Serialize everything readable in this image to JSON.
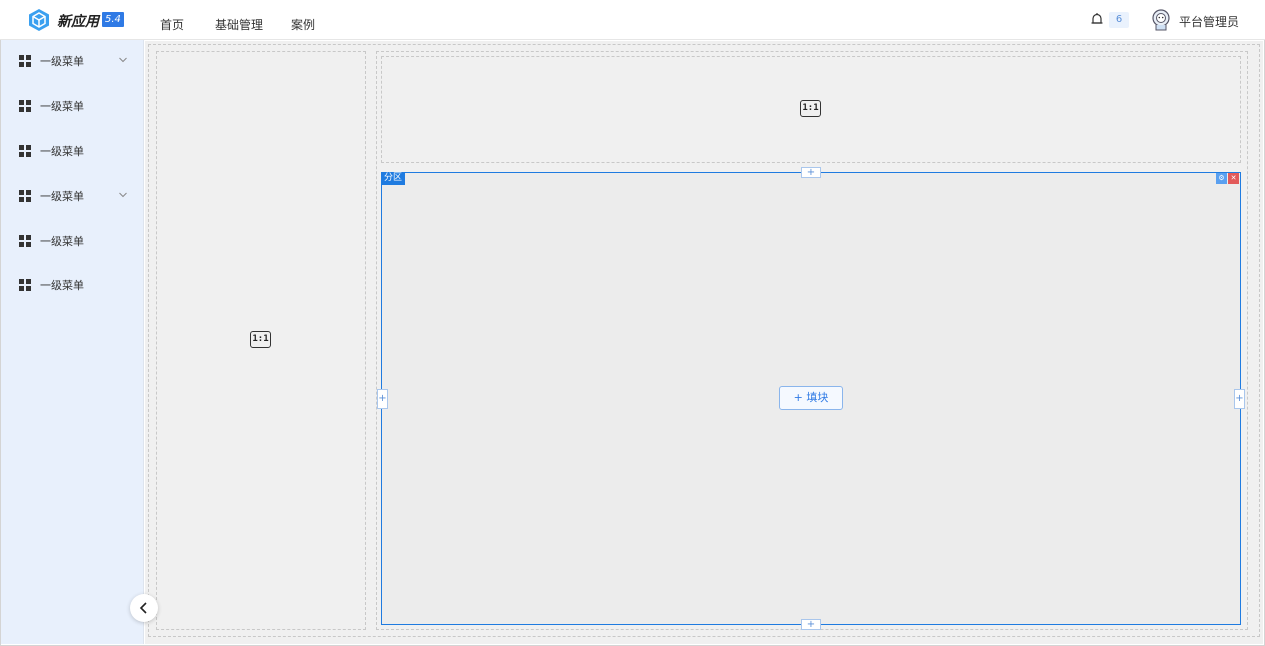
{
  "header": {
    "app_name": "新应用",
    "version": "5.4",
    "nav": [
      "首页",
      "基础管理",
      "案例"
    ],
    "notification_count": "6",
    "user_name": "平台管理员"
  },
  "sidebar": {
    "items": [
      {
        "label": "一级菜单",
        "has_children": true
      },
      {
        "label": "一级菜单",
        "has_children": false
      },
      {
        "label": "一级菜单",
        "has_children": false
      },
      {
        "label": "一级菜单",
        "has_children": true
      },
      {
        "label": "一级菜单",
        "has_children": false
      },
      {
        "label": "一级菜单",
        "has_children": false
      }
    ]
  },
  "canvas": {
    "left_panel_ratio": "1:1",
    "top_panel_ratio": "1:1",
    "section_label": "分区",
    "fill_button": "填块",
    "plus_symbol": "+"
  },
  "colors": {
    "accent": "#1f7be0",
    "sidebar_bg": "#e8f0fc",
    "delete": "#e25a5a"
  }
}
